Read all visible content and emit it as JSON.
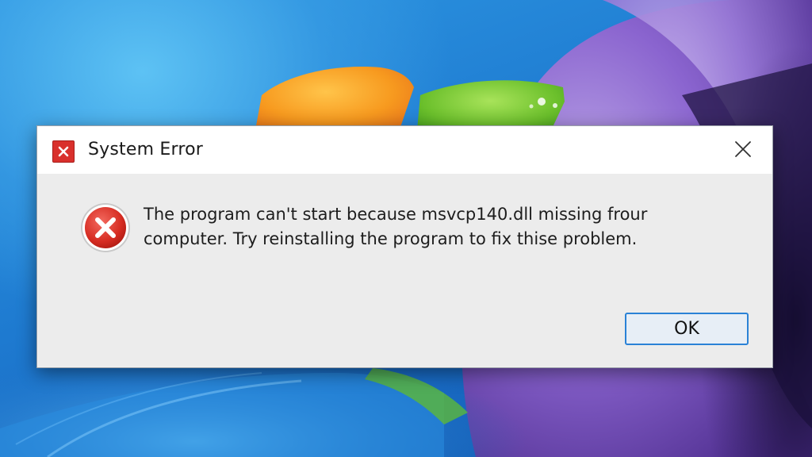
{
  "dialog": {
    "title": "System Error",
    "title_icon": "error-x-icon",
    "close_icon": "close-icon",
    "message_line1": "The program can't start because msvcp140.dll missing frour",
    "message_line2": "computer. Try reinstalling the program to fix thise problem.",
    "message_icon": "error-circle-icon",
    "ok_label": "OK"
  },
  "colors": {
    "error_red": "#d9302c",
    "button_border": "#2a82d6",
    "dialog_bg": "#ececec",
    "titlebar_bg": "#ffffff"
  }
}
